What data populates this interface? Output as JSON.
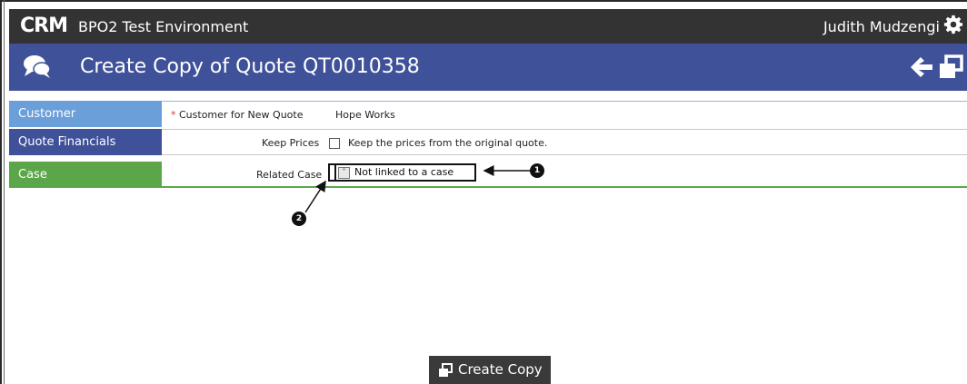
{
  "app": {
    "logo_text": "CRM",
    "environment": "BPO2 Test Environment",
    "user_name": "Judith Mudzengi",
    "icons": {
      "settings": "gear-icon",
      "header": "chat-bubbles-icon",
      "back": "back-arrow-icon",
      "copy": "copy-icon"
    }
  },
  "page": {
    "title": "Create Copy of Quote QT0010358"
  },
  "sections": [
    {
      "label": "Customer",
      "color": "#6b9fd9",
      "field_label": "Customer for New Quote",
      "required_marker": "*",
      "value": "Hope Works"
    },
    {
      "label": "Quote Financials",
      "color": "#3f5199",
      "field_label": "Keep Prices",
      "checkbox_checked": false,
      "checkbox_text": "Keep the prices from the original quote."
    },
    {
      "label": "Case",
      "color": "#5ca64a",
      "field_label": "Related Case",
      "select_value": "Not linked to a case",
      "select_arrow": "˅"
    }
  ],
  "callouts": [
    "1",
    "2"
  ],
  "actions": {
    "create_copy_label": "Create Copy"
  },
  "colors": {
    "topbar": "#333333",
    "titlebar": "#3f5199",
    "button": "#3a3a3a"
  }
}
